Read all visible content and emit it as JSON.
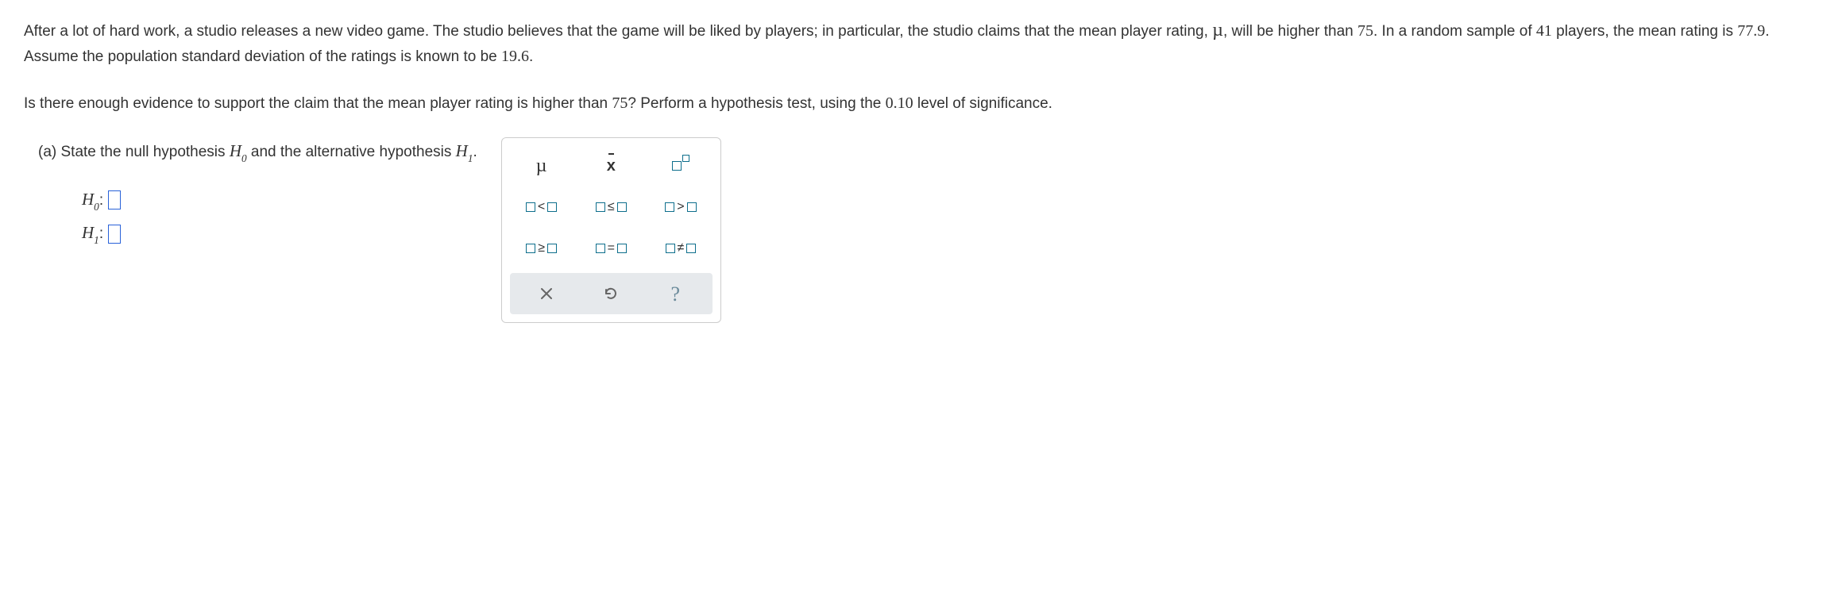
{
  "problem": {
    "paragraph1_parts": {
      "p1": "After a lot of hard work, a studio releases a new video game. The studio believes that the game will be liked by players; in particular, the studio claims that the mean player rating, ",
      "mu": "µ",
      "p2": ", will be higher than ",
      "v1": "75",
      "p3": ". In a random sample of ",
      "v2": "41",
      "p4": " players, the mean rating is ",
      "v3": "77.9",
      "p5": ". Assume the population standard deviation of the ratings is known to be ",
      "v4": "19.6",
      "p6": "."
    },
    "paragraph2_parts": {
      "p1": "Is there enough evidence to support the claim that the mean player rating is higher than ",
      "v1": "75",
      "p2": "? Perform a hypothesis test, using the ",
      "v2": "0.10",
      "p3": " level of significance."
    },
    "part_a": {
      "prefix": "(a) State the null hypothesis ",
      "h0": "H",
      "h0sub": "0",
      "mid": " and the alternative hypothesis ",
      "h1": "H",
      "h1sub": "1",
      "suffix": "."
    },
    "h0_label": {
      "sym": "H",
      "sub": "0",
      "colon": ":"
    },
    "h1_label": {
      "sym": "H",
      "sub": "1",
      "colon": ":"
    }
  },
  "palette": {
    "mu": "µ",
    "xbar": "x",
    "lt": "<",
    "le": "≤",
    "gt": ">",
    "ge": "≥",
    "eq": "=",
    "ne": "≠",
    "help": "?"
  }
}
